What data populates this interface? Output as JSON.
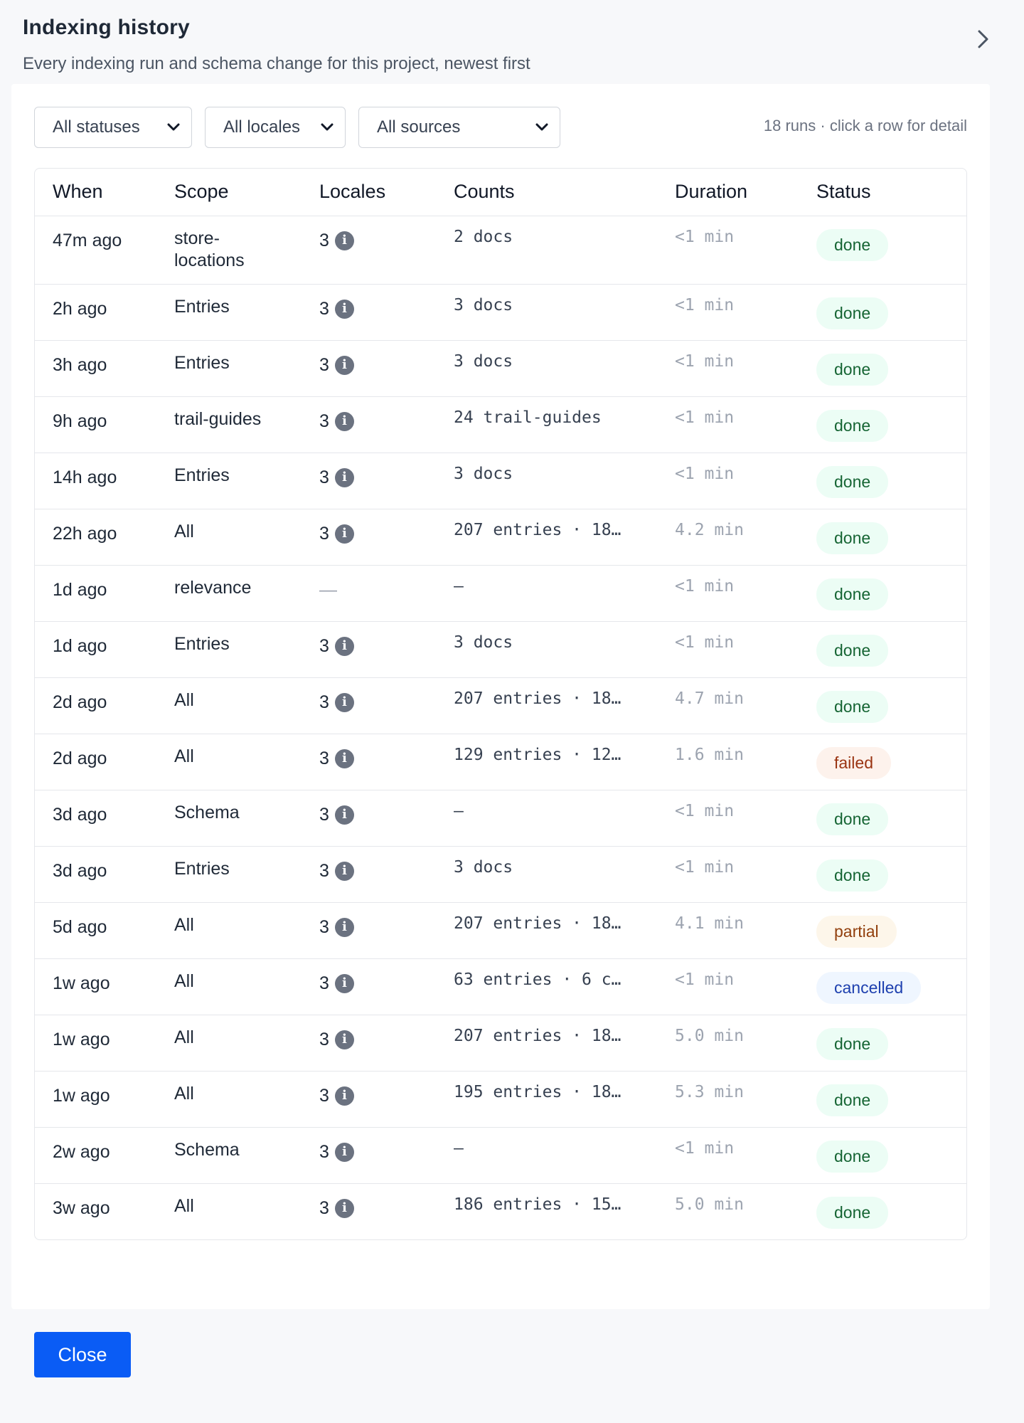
{
  "header": {
    "title": "Indexing history",
    "subtitle": "Every indexing run and schema change for this project, newest first",
    "collapse_icon": "chevron-right-icon"
  },
  "filters": {
    "status": "All statuses",
    "locale": "All locales",
    "source": "All sources"
  },
  "meta": "18 runs · click a row for detail",
  "table": {
    "columns": [
      "When",
      "Scope",
      "Locales",
      "Counts",
      "Duration",
      "Status"
    ],
    "rows": [
      {
        "when": "47m ago",
        "scope": "store-\nlocations",
        "locales": "3",
        "counts": "2 docs",
        "duration": "<1 min",
        "status": "done"
      },
      {
        "when": "2h ago",
        "scope": "Entries",
        "locales": "3",
        "counts": "3 docs",
        "duration": "<1 min",
        "status": "done"
      },
      {
        "when": "3h ago",
        "scope": "Entries",
        "locales": "3",
        "counts": "3 docs",
        "duration": "<1 min",
        "status": "done"
      },
      {
        "when": "9h ago",
        "scope": "trail-guides",
        "locales": "3",
        "counts": "24 trail-guides",
        "duration": "<1 min",
        "status": "done"
      },
      {
        "when": "14h ago",
        "scope": "Entries",
        "locales": "3",
        "counts": "3 docs",
        "duration": "<1 min",
        "status": "done"
      },
      {
        "when": "22h ago",
        "scope": "All",
        "locales": "3",
        "counts": "207 entries · 18…",
        "duration": "4.2 min",
        "status": "done"
      },
      {
        "when": "1d ago",
        "scope": "relevance",
        "locales": "—",
        "counts": "–",
        "duration": "<1 min",
        "status": "done"
      },
      {
        "when": "1d ago",
        "scope": "Entries",
        "locales": "3",
        "counts": "3 docs",
        "duration": "<1 min",
        "status": "done"
      },
      {
        "when": "2d ago",
        "scope": "All",
        "locales": "3",
        "counts": "207 entries · 18…",
        "duration": "4.7 min",
        "status": "done"
      },
      {
        "when": "2d ago",
        "scope": "All",
        "locales": "3",
        "counts": "129 entries · 12…",
        "duration": "1.6 min",
        "status": "failed"
      },
      {
        "when": "3d ago",
        "scope": "Schema",
        "locales": "3",
        "counts": "–",
        "duration": "<1 min",
        "status": "done"
      },
      {
        "when": "3d ago",
        "scope": "Entries",
        "locales": "3",
        "counts": "3 docs",
        "duration": "<1 min",
        "status": "done"
      },
      {
        "when": "5d ago",
        "scope": "All",
        "locales": "3",
        "counts": "207 entries · 18…",
        "duration": "4.1 min",
        "status": "partial"
      },
      {
        "when": "1w ago",
        "scope": "All",
        "locales": "3",
        "counts": "63 entries · 6 c…",
        "duration": "<1 min",
        "status": "cancelled"
      },
      {
        "when": "1w ago",
        "scope": "All",
        "locales": "3",
        "counts": "207 entries · 18…",
        "duration": "5.0 min",
        "status": "done"
      },
      {
        "when": "1w ago",
        "scope": "All",
        "locales": "3",
        "counts": "195 entries · 18…",
        "duration": "5.3 min",
        "status": "done"
      },
      {
        "when": "2w ago",
        "scope": "Schema",
        "locales": "3",
        "counts": "–",
        "duration": "<1 min",
        "status": "done"
      },
      {
        "when": "3w ago",
        "scope": "All",
        "locales": "3",
        "counts": "186 entries · 15…",
        "duration": "5.0 min",
        "status": "done"
      }
    ]
  },
  "footer": {
    "close_label": "Close"
  },
  "colors": {
    "accent": "#0a5cf5",
    "done_bg": "#ecfdf5",
    "done_fg": "#166534",
    "failed_bg": "#fdf2ec",
    "failed_fg": "#9a3412",
    "partial_bg": "#fdf6ea",
    "partial_fg": "#92400e",
    "cancelled_bg": "#eff6ff",
    "cancelled_fg": "#1e40af"
  }
}
